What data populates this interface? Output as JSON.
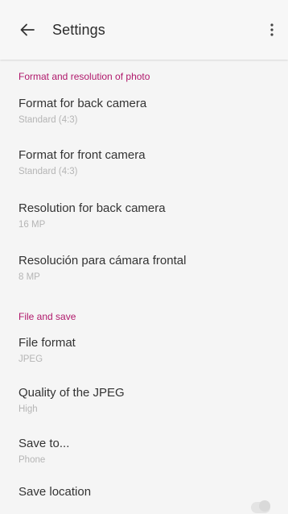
{
  "header": {
    "title": "Settings"
  },
  "sections": {
    "format": {
      "title": "Format and resolution of photo",
      "items": [
        {
          "title": "Format for back camera",
          "value": "Standard (4:3)"
        },
        {
          "title": "Format for front camera",
          "value": "Standard (4:3)"
        },
        {
          "title": "Resolution for back camera",
          "value": "16 MP"
        },
        {
          "title": "Resolución para cámara frontal",
          "value": "8 MP"
        }
      ]
    },
    "file": {
      "title": "File and save",
      "items": [
        {
          "title": "File format",
          "value": "JPEG"
        },
        {
          "title": "Quality of the JPEG",
          "value": "High"
        },
        {
          "title": "Save to...",
          "value": "Phone"
        },
        {
          "title": "Save location",
          "toggle": false
        }
      ]
    }
  },
  "colors": {
    "accent": "#b0186b",
    "background": "#f5f5f5",
    "primary_text": "#333333",
    "secondary_text": "#b5b5b5"
  },
  "icons": {
    "back": "arrow-left-icon",
    "more": "more-vert-icon"
  }
}
